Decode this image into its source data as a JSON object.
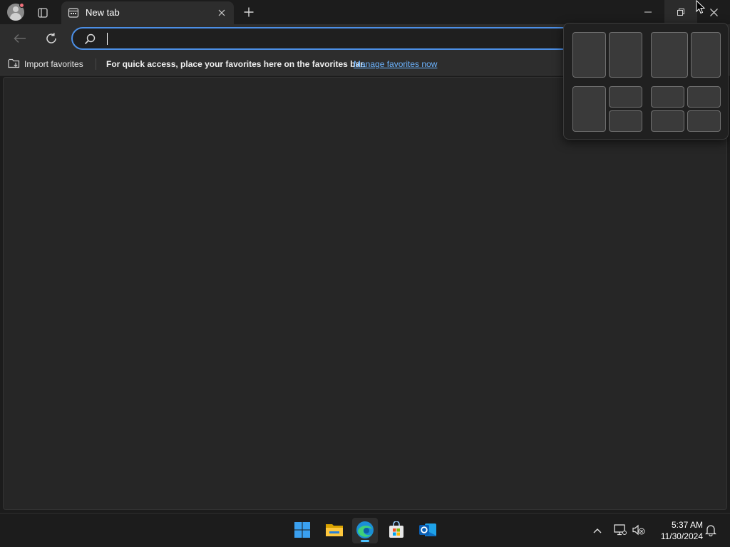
{
  "browser": {
    "tab": {
      "title": "New tab"
    },
    "omnibox": {
      "value": "",
      "placeholder": ""
    },
    "favorites_bar": {
      "import_label": "Import favorites",
      "message": "For quick access, place your favorites here on the favorites bar.",
      "manage_link": "Manage favorites now"
    }
  },
  "snap_layouts": {
    "layouts": [
      "two-column-equal",
      "two-column-wide-left",
      "main-plus-two-stacked",
      "four-grid"
    ]
  },
  "taskbar": {
    "apps": [
      "start",
      "file-explorer",
      "edge",
      "microsoft-store",
      "outlook"
    ],
    "active_app": "edge",
    "clock": {
      "time": "5:37 AM",
      "date": "11/30/2024"
    }
  },
  "colors": {
    "accent": "#4c8fe6",
    "link": "#6cb4ff",
    "taskbar_indicator": "#4cc2ff"
  }
}
